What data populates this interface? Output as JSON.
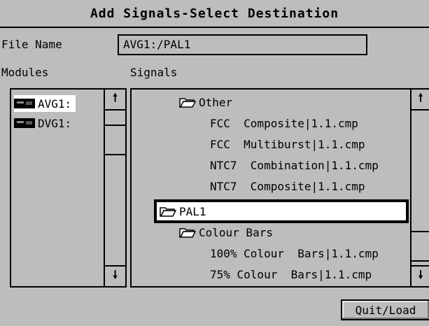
{
  "window": {
    "title": "Add Signals-Select Destination"
  },
  "file_name": {
    "label": "File Name",
    "value": "AVG1:/PAL1"
  },
  "modules": {
    "label": "Modules",
    "items": [
      {
        "label": "AVG1:",
        "selected": true,
        "icon": "module-icon"
      },
      {
        "label": "DVG1:",
        "selected": false,
        "icon": "module-icon"
      }
    ]
  },
  "signals": {
    "label": "Signals",
    "items": [
      {
        "label": "Other",
        "type": "folder"
      },
      {
        "label": "FCC  Composite|1.1.cmp",
        "type": "file"
      },
      {
        "label": "FCC  Multiburst|1.1.cmp",
        "type": "file"
      },
      {
        "label": "NTC7  Combination|1.1.cmp",
        "type": "file"
      },
      {
        "label": "NTC7  Composite|1.1.cmp",
        "type": "file"
      },
      {
        "label": "PAL1",
        "type": "folder",
        "selected": true
      },
      {
        "label": "Colour Bars",
        "type": "folder"
      },
      {
        "label": "100% Colour  Bars|1.1.cmp",
        "type": "file"
      },
      {
        "label": "75% Colour  Bars|1.1.cmp",
        "type": "file"
      }
    ]
  },
  "scroll": {
    "up": "🠕",
    "down": "🠗"
  },
  "buttons": {
    "quit_load": "Quit/Load"
  }
}
